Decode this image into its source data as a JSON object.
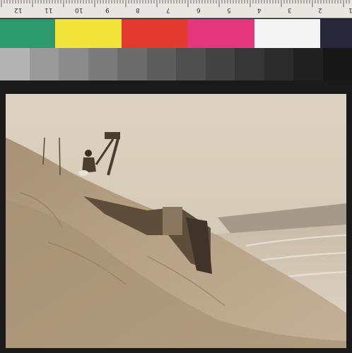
{
  "ruler": {
    "numbers": [
      "12",
      "11",
      "10",
      "9",
      "8",
      "7",
      "6",
      "5",
      "4",
      "3",
      "2",
      "1"
    ]
  },
  "color_patches": [
    "#2c9a6d",
    "#f2e33a",
    "#e23a2f",
    "#e3367d",
    "#f4f4f4",
    "#29283a"
  ],
  "gray_patches": [
    "#b3b3b3",
    "#9a9a9a",
    "#8b8b8b",
    "#7b7b7b",
    "#6c6c6c",
    "#5d5d5d",
    "#4f4f4f",
    "#434343",
    "#363636",
    "#2b2b2b",
    "#212121",
    "#171717"
  ],
  "photo": {
    "subject": "sepia photograph of a person seated on a sand dune beside a wooden structure, ocean waves in the background"
  }
}
